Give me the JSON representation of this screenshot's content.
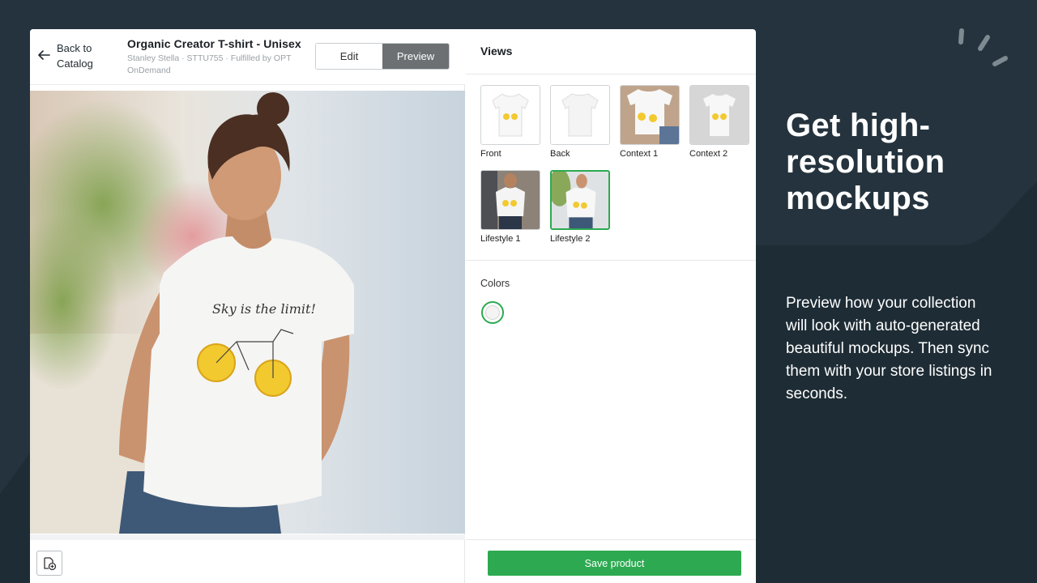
{
  "header": {
    "back_label": "Back to Catalog",
    "product_title": "Organic Creator T-shirt - Unisex",
    "product_subtitle": "Stanley Stella · STTU755 · Fulfilled by OPT OnDemand",
    "edit_label": "Edit",
    "preview_label": "Preview"
  },
  "preview": {
    "shirt_text": "Sky is the limit!",
    "selected_view": "Lifestyle 2"
  },
  "views": {
    "heading": "Views",
    "items": [
      {
        "label": "Front",
        "selected": false
      },
      {
        "label": "Back",
        "selected": false
      },
      {
        "label": "Context 1",
        "selected": false
      },
      {
        "label": "Context 2",
        "selected": false
      },
      {
        "label": "Lifestyle 1",
        "selected": false
      },
      {
        "label": "Lifestyle 2",
        "selected": true
      }
    ]
  },
  "colors": {
    "heading": "Colors",
    "selected": "#f4f4f4"
  },
  "actions": {
    "save_label": "Save product"
  },
  "promo": {
    "title": "Get high-resolution mockups",
    "text": "Preview how your collection will look with auto-generated beautiful mockups. Then sync them with your store listings in seconds."
  },
  "theme": {
    "accent": "#2daa51",
    "background": "#1e2c35",
    "background_panel": "#24333d"
  }
}
